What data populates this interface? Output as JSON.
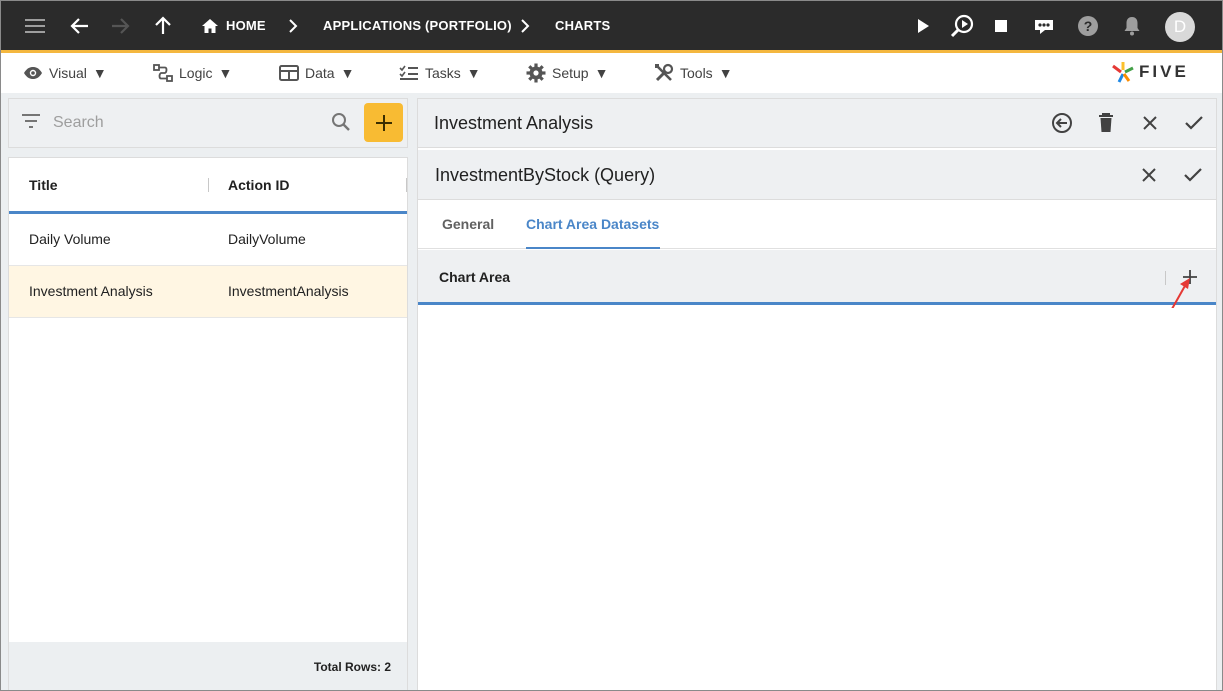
{
  "topbar": {
    "breadcrumbs": [
      "HOME",
      "APPLICATIONS (PORTFOLIO)",
      "CHARTS"
    ],
    "user_initial": "D",
    "accent_color": "#f4b73f"
  },
  "menu": {
    "items": [
      {
        "label": "Visual",
        "icon": "eye-icon"
      },
      {
        "label": "Logic",
        "icon": "logic-icon"
      },
      {
        "label": "Data",
        "icon": "table-icon"
      },
      {
        "label": "Tasks",
        "icon": "tasks-icon"
      },
      {
        "label": "Setup",
        "icon": "gear-icon"
      },
      {
        "label": "Tools",
        "icon": "tools-icon"
      }
    ],
    "caret": "▼",
    "logo_text": "FIVE"
  },
  "list": {
    "search_placeholder": "Search",
    "columns": [
      "Title",
      "Action ID"
    ],
    "rows": [
      {
        "title": "Daily Volume",
        "action_id": "DailyVolume",
        "selected": false
      },
      {
        "title": "Investment Analysis",
        "action_id": "InvestmentAnalysis",
        "selected": true
      }
    ],
    "total_rows": "Total Rows: 2"
  },
  "form": {
    "title": "Investment Analysis",
    "sub_title": "InvestmentByStock (Query)",
    "tabs": [
      "General",
      "Chart Area Datasets"
    ],
    "active_tab": "Chart Area Datasets",
    "grid_column": "Chart Area",
    "accent_color": "#4a86c8"
  }
}
